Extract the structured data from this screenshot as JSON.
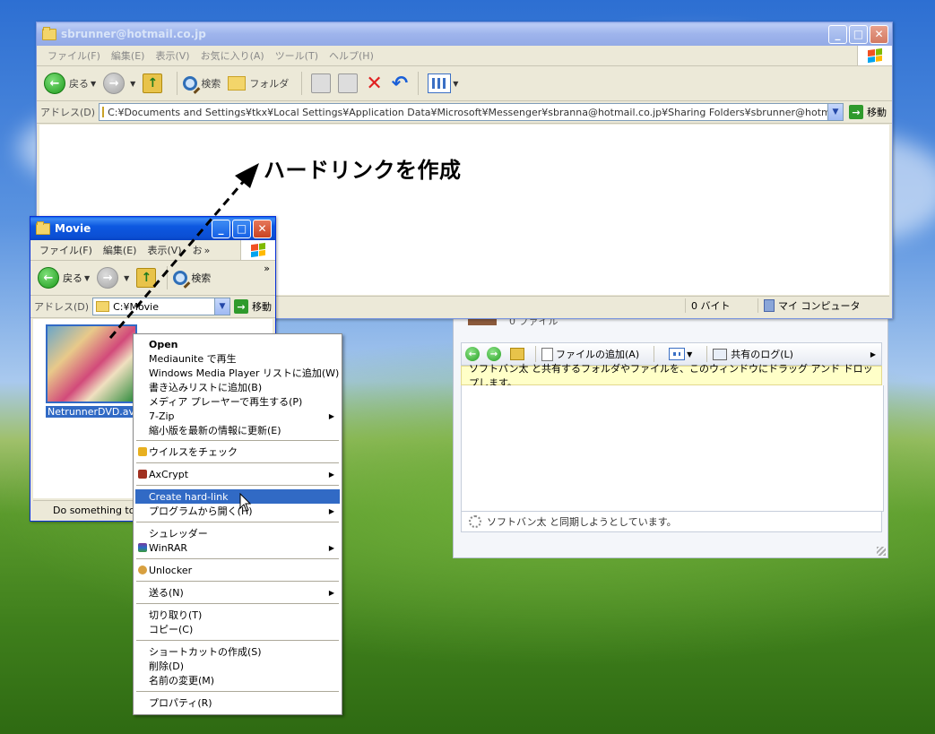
{
  "main_window": {
    "title": "sbrunner@hotmail.co.jp",
    "menu": [
      "ファイル(F)",
      "編集(E)",
      "表示(V)",
      "お気に入り(A)",
      "ツール(T)",
      "ヘルプ(H)"
    ],
    "toolbar": {
      "back": "戻る",
      "search": "検索",
      "folders": "フォルダ"
    },
    "address_label": "アドレス(D)",
    "address_value": "C:¥Documents and Settings¥tkx¥Local Settings¥Application Data¥Microsoft¥Messenger¥sbranna@hotmail.co.jp¥Sharing Folders¥sbrunner@hotmail.co.jp",
    "go_label": "移動",
    "status": {
      "size": "0 バイト",
      "zone": "マイ コンピュータ"
    }
  },
  "movie_window": {
    "title": "Movie",
    "menu": [
      "ファイル(F)",
      "編集(E)",
      "表示(V)",
      "お"
    ],
    "menu_more": "»",
    "toolbar": {
      "back": "戻る",
      "search": "検索",
      "more": "»"
    },
    "address_label": "アドレス(D)",
    "address_value": "C:¥Movie",
    "go_label": "移動",
    "file_name": "NetrunnerDVD.avi",
    "status_text": "Do something to f"
  },
  "sharing_window": {
    "file_count": "0 ファイル",
    "toolbar": {
      "add_file": "ファイルの追加(A)",
      "log": "共有のログ(L)"
    },
    "info": "ソフトバン太 と共有するフォルダやファイルを、このウィンドウにドラッグ アンド ドロップします。",
    "status": "ソフトバン太 と同期しようとしています。"
  },
  "context_menu": {
    "items": [
      {
        "label": "Open",
        "bold": true
      },
      {
        "label": "Mediaunite で再生"
      },
      {
        "label": "Windows Media Player リストに追加(W)"
      },
      {
        "label": "書き込みリストに追加(B)"
      },
      {
        "label": "メディア プレーヤーで再生する(P)"
      },
      {
        "label": "7-Zip",
        "submenu": true
      },
      {
        "label": "縮小版を最新の情報に更新(E)"
      },
      {
        "label": "ウイルスをチェック"
      },
      {
        "label": "AxCrypt",
        "submenu": true
      },
      {
        "label": "Create hard-link",
        "selected": true
      },
      {
        "label": "プログラムから開く(H)",
        "submenu": true
      },
      {
        "label": "シュレッダー"
      },
      {
        "label": "WinRAR",
        "submenu": true
      },
      {
        "label": "Unlocker"
      },
      {
        "label": "送る(N)",
        "submenu": true
      },
      {
        "label": "切り取り(T)"
      },
      {
        "label": "コピー(C)"
      },
      {
        "label": "ショートカットの作成(S)"
      },
      {
        "label": "削除(D)"
      },
      {
        "label": "名前の変更(M)"
      },
      {
        "label": "プロパティ(R)"
      }
    ]
  },
  "annotation": "ハードリンクを作成",
  "colors": {
    "selection": "#316ac5",
    "xp_title": "#0b4fd4",
    "info_bar": "#ffffc8"
  }
}
